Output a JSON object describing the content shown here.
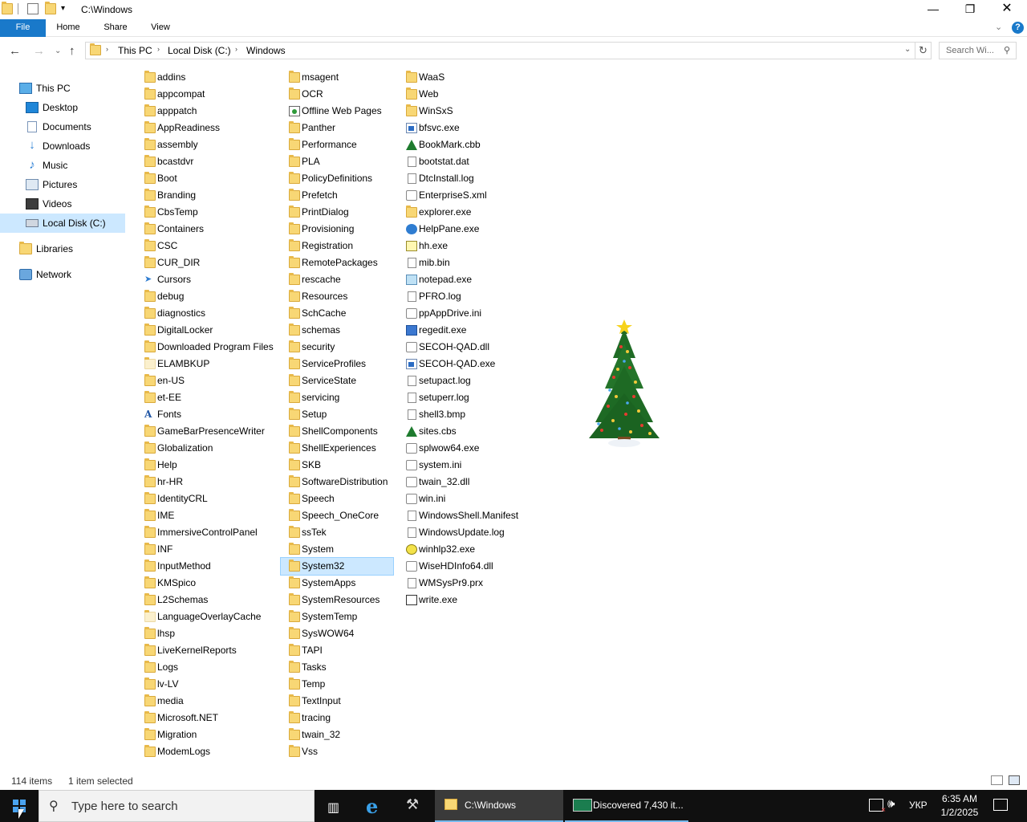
{
  "window": {
    "title": "C:\\Windows",
    "controls": {
      "minimize": "—",
      "maximize": "❐",
      "close": "✕"
    }
  },
  "ribbon": {
    "tabs": [
      "File",
      "Home",
      "Share",
      "View"
    ],
    "collapse_chevron": "⌄",
    "help": "?"
  },
  "address_bar": {
    "breadcrumbs": [
      "This PC",
      "Local Disk (C:)",
      "Windows"
    ],
    "separator": "›",
    "dropdown": "⌄",
    "refresh": "↻",
    "search_placeholder": "Search Wi..."
  },
  "nav_buttons": {
    "back": "←",
    "forward": "→",
    "recent": "⌄",
    "up": "↑"
  },
  "nav_pane": {
    "items": [
      {
        "label": "This PC",
        "icon": "pc-icon"
      },
      {
        "label": "Desktop",
        "icon": "desktop-icon"
      },
      {
        "label": "Documents",
        "icon": "documents-icon"
      },
      {
        "label": "Downloads",
        "icon": "downloads-icon"
      },
      {
        "label": "Music",
        "icon": "music-icon"
      },
      {
        "label": "Pictures",
        "icon": "pictures-icon"
      },
      {
        "label": "Videos",
        "icon": "videos-icon"
      },
      {
        "label": "Local Disk (C:)",
        "icon": "drive-icon",
        "selected": true
      },
      {
        "label": "Libraries",
        "icon": "libraries-icon"
      },
      {
        "label": "Network",
        "icon": "network-icon"
      }
    ]
  },
  "files": {
    "column1": [
      {
        "name": "addins",
        "type": "folder"
      },
      {
        "name": "appcompat",
        "type": "folder"
      },
      {
        "name": "apppatch",
        "type": "folder"
      },
      {
        "name": "AppReadiness",
        "type": "folder"
      },
      {
        "name": "assembly",
        "type": "folder"
      },
      {
        "name": "bcastdvr",
        "type": "folder"
      },
      {
        "name": "Boot",
        "type": "folder"
      },
      {
        "name": "Branding",
        "type": "folder"
      },
      {
        "name": "CbsTemp",
        "type": "folder"
      },
      {
        "name": "Containers",
        "type": "folder"
      },
      {
        "name": "CSC",
        "type": "folder"
      },
      {
        "name": "CUR_DIR",
        "type": "folder"
      },
      {
        "name": "Cursors",
        "type": "cursors"
      },
      {
        "name": "debug",
        "type": "folder"
      },
      {
        "name": "diagnostics",
        "type": "folder"
      },
      {
        "name": "DigitalLocker",
        "type": "folder"
      },
      {
        "name": "Downloaded Program Files",
        "type": "folder"
      },
      {
        "name": "ELAMBKUP",
        "type": "folder-faded"
      },
      {
        "name": "en-US",
        "type": "folder"
      },
      {
        "name": "et-EE",
        "type": "folder"
      },
      {
        "name": "Fonts",
        "type": "fonts"
      },
      {
        "name": "GameBarPresenceWriter",
        "type": "folder"
      },
      {
        "name": "Globalization",
        "type": "folder"
      },
      {
        "name": "Help",
        "type": "folder"
      },
      {
        "name": "hr-HR",
        "type": "folder"
      },
      {
        "name": "IdentityCRL",
        "type": "folder"
      },
      {
        "name": "IME",
        "type": "folder"
      },
      {
        "name": "ImmersiveControlPanel",
        "type": "folder"
      },
      {
        "name": "INF",
        "type": "folder"
      },
      {
        "name": "InputMethod",
        "type": "folder"
      },
      {
        "name": "KMSpico",
        "type": "folder"
      },
      {
        "name": "L2Schemas",
        "type": "folder"
      },
      {
        "name": "LanguageOverlayCache",
        "type": "folder-faded"
      },
      {
        "name": "lhsp",
        "type": "folder"
      },
      {
        "name": "LiveKernelReports",
        "type": "folder"
      },
      {
        "name": "Logs",
        "type": "folder"
      },
      {
        "name": "lv-LV",
        "type": "folder"
      },
      {
        "name": "media",
        "type": "folder"
      },
      {
        "name": "Microsoft.NET",
        "type": "folder"
      },
      {
        "name": "Migration",
        "type": "folder"
      },
      {
        "name": "ModemLogs",
        "type": "folder"
      }
    ],
    "column2": [
      {
        "name": "msagent",
        "type": "folder"
      },
      {
        "name": "OCR",
        "type": "folder"
      },
      {
        "name": "Offline Web Pages",
        "type": "web"
      },
      {
        "name": "Panther",
        "type": "folder"
      },
      {
        "name": "Performance",
        "type": "folder"
      },
      {
        "name": "PLA",
        "type": "folder"
      },
      {
        "name": "PolicyDefinitions",
        "type": "folder"
      },
      {
        "name": "Prefetch",
        "type": "folder"
      },
      {
        "name": "PrintDialog",
        "type": "folder"
      },
      {
        "name": "Provisioning",
        "type": "folder"
      },
      {
        "name": "Registration",
        "type": "folder"
      },
      {
        "name": "RemotePackages",
        "type": "folder"
      },
      {
        "name": "rescache",
        "type": "folder"
      },
      {
        "name": "Resources",
        "type": "folder"
      },
      {
        "name": "SchCache",
        "type": "folder"
      },
      {
        "name": "schemas",
        "type": "folder"
      },
      {
        "name": "security",
        "type": "folder"
      },
      {
        "name": "ServiceProfiles",
        "type": "folder"
      },
      {
        "name": "ServiceState",
        "type": "folder"
      },
      {
        "name": "servicing",
        "type": "folder"
      },
      {
        "name": "Setup",
        "type": "folder"
      },
      {
        "name": "ShellComponents",
        "type": "folder"
      },
      {
        "name": "ShellExperiences",
        "type": "folder"
      },
      {
        "name": "SKB",
        "type": "folder"
      },
      {
        "name": "SoftwareDistribution",
        "type": "folder"
      },
      {
        "name": "Speech",
        "type": "folder"
      },
      {
        "name": "Speech_OneCore",
        "type": "folder"
      },
      {
        "name": "ssTek",
        "type": "folder"
      },
      {
        "name": "System",
        "type": "folder"
      },
      {
        "name": "System32",
        "type": "folder",
        "selected": true
      },
      {
        "name": "SystemApps",
        "type": "folder"
      },
      {
        "name": "SystemResources",
        "type": "folder"
      },
      {
        "name": "SystemTemp",
        "type": "folder"
      },
      {
        "name": "SysWOW64",
        "type": "folder"
      },
      {
        "name": "TAPI",
        "type": "folder"
      },
      {
        "name": "Tasks",
        "type": "folder"
      },
      {
        "name": "Temp",
        "type": "folder"
      },
      {
        "name": "TextInput",
        "type": "folder"
      },
      {
        "name": "tracing",
        "type": "folder"
      },
      {
        "name": "twain_32",
        "type": "folder"
      },
      {
        "name": "Vss",
        "type": "folder"
      }
    ],
    "column3": [
      {
        "name": "WaaS",
        "type": "folder"
      },
      {
        "name": "Web",
        "type": "folder"
      },
      {
        "name": "WinSxS",
        "type": "folder"
      },
      {
        "name": "bfsvc.exe",
        "type": "exe"
      },
      {
        "name": "BookMark.cbb",
        "type": "tree"
      },
      {
        "name": "bootstat.dat",
        "type": "doc"
      },
      {
        "name": "DtcInstall.log",
        "type": "doc"
      },
      {
        "name": "EnterpriseS.xml",
        "type": "gear"
      },
      {
        "name": "explorer.exe",
        "type": "folder"
      },
      {
        "name": "HelpPane.exe",
        "type": "help"
      },
      {
        "name": "hh.exe",
        "type": "hh"
      },
      {
        "name": "mib.bin",
        "type": "doc"
      },
      {
        "name": "notepad.exe",
        "type": "notepad"
      },
      {
        "name": "PFRO.log",
        "type": "doc"
      },
      {
        "name": "ppAppDrive.ini",
        "type": "gear"
      },
      {
        "name": "regedit.exe",
        "type": "regedit"
      },
      {
        "name": "SECOH-QAD.dll",
        "type": "gear"
      },
      {
        "name": "SECOH-QAD.exe",
        "type": "exe"
      },
      {
        "name": "setupact.log",
        "type": "doc"
      },
      {
        "name": "setuperr.log",
        "type": "doc"
      },
      {
        "name": "shell3.bmp",
        "type": "doc"
      },
      {
        "name": "sites.cbs",
        "type": "tree"
      },
      {
        "name": "splwow64.exe",
        "type": "gear"
      },
      {
        "name": "system.ini",
        "type": "gear"
      },
      {
        "name": "twain_32.dll",
        "type": "gear"
      },
      {
        "name": "win.ini",
        "type": "gear"
      },
      {
        "name": "WindowsShell.Manifest",
        "type": "doc"
      },
      {
        "name": "WindowsUpdate.log",
        "type": "doc"
      },
      {
        "name": "winhlp32.exe",
        "type": "question"
      },
      {
        "name": "WiseHDInfo64.dll",
        "type": "gear"
      },
      {
        "name": "WMSysPr9.prx",
        "type": "doc"
      },
      {
        "name": "write.exe",
        "type": "write"
      }
    ]
  },
  "status_bar": {
    "item_count": "114 items",
    "selection": "1 item selected"
  },
  "taskbar": {
    "search_placeholder": "Type here to search",
    "buttons": [
      {
        "label": "C:\\Windows",
        "icon": "folder-icon",
        "active": true
      },
      {
        "label": "Discovered 7,430 it...",
        "icon": "scanner-app-icon",
        "active": false
      }
    ],
    "tray": {
      "language": "УКР",
      "time": "6:35 AM",
      "date": "1/2/2025"
    }
  },
  "colors": {
    "accent": "#1979ca",
    "selection": "#cce8ff",
    "folder": "#f8d775",
    "taskbar": "#101010"
  }
}
